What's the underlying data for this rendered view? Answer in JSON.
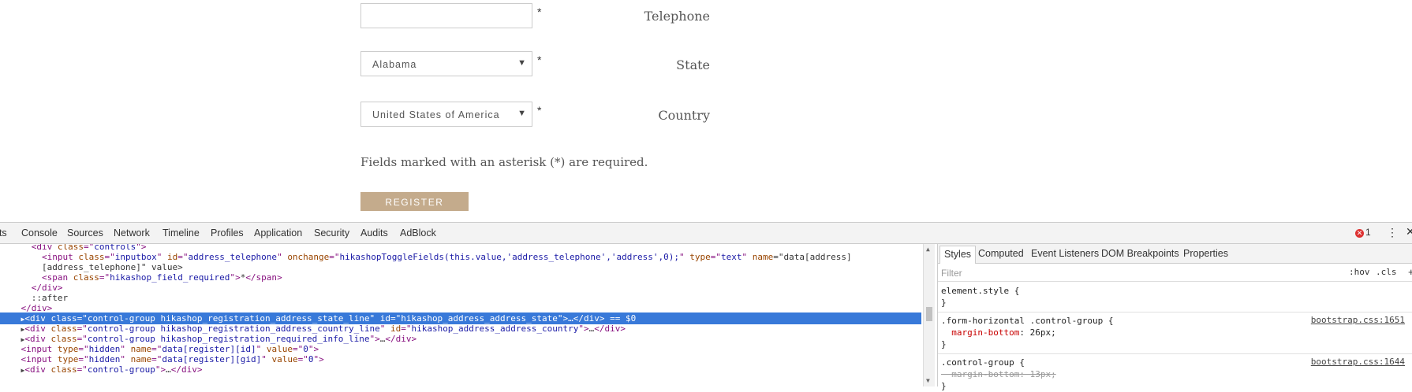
{
  "form": {
    "telephone_label": "Telephone",
    "telephone_value": "",
    "state_label": "State",
    "state_value": "Alabama",
    "country_label": "Country",
    "country_value": "United States of America",
    "required_mark": "*",
    "note": "Fields marked with an asterisk (*) are required.",
    "register_label": "REGISTER",
    "accent_color": "#c4ab8c"
  },
  "devtools": {
    "tabs": [
      "nts",
      "Console",
      "Sources",
      "Network",
      "Timeline",
      "Profiles",
      "Application",
      "Security",
      "Audits",
      "AdBlock"
    ],
    "error_count": "1",
    "error_icon": "✕",
    "menu_icon": "⋮",
    "close_icon": "✕",
    "elements": [
      {
        "indent": "      ",
        "tri": "",
        "html": "<div class=\"controls\">"
      },
      {
        "indent": "        ",
        "tri": "",
        "html": "<input class=\"inputbox\" id=\"address_telephone\" onchange=\"hikashopToggleFields(this.value,'address_telephone','address',0);\" type=\"text\" name=\"data[address]"
      },
      {
        "indent": "        ",
        "tri": "",
        "html": "[address_telephone]\" value>"
      },
      {
        "indent": "        ",
        "tri": "",
        "html": "<span class=\"hikashop_field_required\">*</span>"
      },
      {
        "indent": "      ",
        "tri": "",
        "html": "</div>"
      },
      {
        "indent": "      ",
        "tri": "",
        "html": "::after"
      },
      {
        "indent": "    ",
        "tri": "",
        "html": "</div>"
      },
      {
        "indent": "    ",
        "tri": "▶",
        "html": "<div class=\"control-group hikashop_registration_address_state_line\" id=\"hikashop_address_address_state\">…</div> == $0"
      },
      {
        "indent": "    ",
        "tri": "▶",
        "html": "<div class=\"control-group hikashop_registration_address_country_line\" id=\"hikashop_address_address_country\">…</div>"
      },
      {
        "indent": "    ",
        "tri": "▶",
        "html": "<div class=\"control-group hikashop_registration_required_info_line\">…</div>"
      },
      {
        "indent": "    ",
        "tri": "",
        "html": "<input type=\"hidden\" name=\"data[register][id]\" value=\"0\">"
      },
      {
        "indent": "    ",
        "tri": "",
        "html": "<input type=\"hidden\" name=\"data[register][gid]\" value=\"0\">"
      },
      {
        "indent": "    ",
        "tri": "▶",
        "html": "<div class=\"control-group\">…</div>"
      }
    ],
    "selected_index": 7,
    "styles_tabs": [
      "Styles",
      "Computed",
      "Event Listeners",
      "DOM Breakpoints",
      "Properties"
    ],
    "filter_placeholder": "Filter",
    "hov_label": ":hov",
    "cls_label": ".cls",
    "plus_label": "+",
    "rules": [
      {
        "selector": "element.style {",
        "props": [],
        "close": "}",
        "source": ""
      },
      {
        "selector": ".form-horizontal .control-group {",
        "props": [
          {
            "name": "margin-bottom",
            "value": "26px;",
            "struck": false
          }
        ],
        "close": "}",
        "source": "bootstrap.css:1651"
      },
      {
        "selector": ".control-group {",
        "props": [
          {
            "name": "margin-bottom",
            "value": "13px;",
            "struck": true
          }
        ],
        "close": "}",
        "source": "bootstrap.css:1644"
      }
    ]
  }
}
